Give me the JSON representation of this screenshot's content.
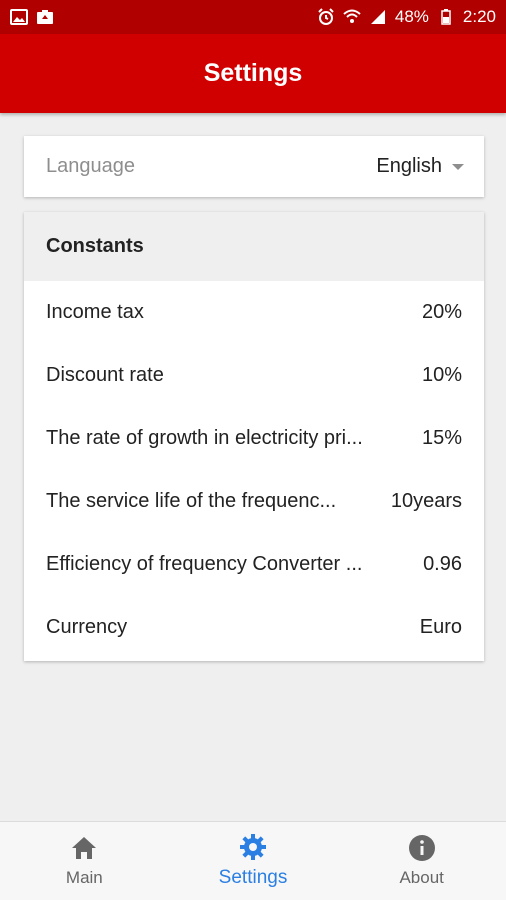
{
  "status_bar": {
    "battery": "48%",
    "time": "2:20",
    "left_icons": [
      "image-icon",
      "photo-upload-icon"
    ],
    "right_icons": [
      "alarm-icon",
      "wifi-icon",
      "signal-icon",
      "battery-icon"
    ]
  },
  "appbar": {
    "title": "Settings"
  },
  "language": {
    "label": "Language",
    "value": "English"
  },
  "constants": {
    "header": "Constants",
    "items": [
      {
        "label": "Income tax",
        "value": "20%"
      },
      {
        "label": "Discount rate",
        "value": "10%"
      },
      {
        "label": "The rate of growth in electricity pri...",
        "value": "15%"
      },
      {
        "label": "The service life of the frequenc...",
        "value": "10years"
      },
      {
        "label": "Efficiency of frequency Converter ...",
        "value": "0.96"
      },
      {
        "label": "Currency",
        "value": "Euro"
      }
    ]
  },
  "bottom_nav": {
    "items": [
      {
        "label": "Main",
        "icon": "home-icon"
      },
      {
        "label": "Settings",
        "icon": "gear-icon",
        "active": true
      },
      {
        "label": "About",
        "icon": "info-icon"
      }
    ]
  },
  "colors": {
    "statusbar": "#b00000",
    "appbar": "#d10000",
    "active": "#2b7fe3"
  }
}
